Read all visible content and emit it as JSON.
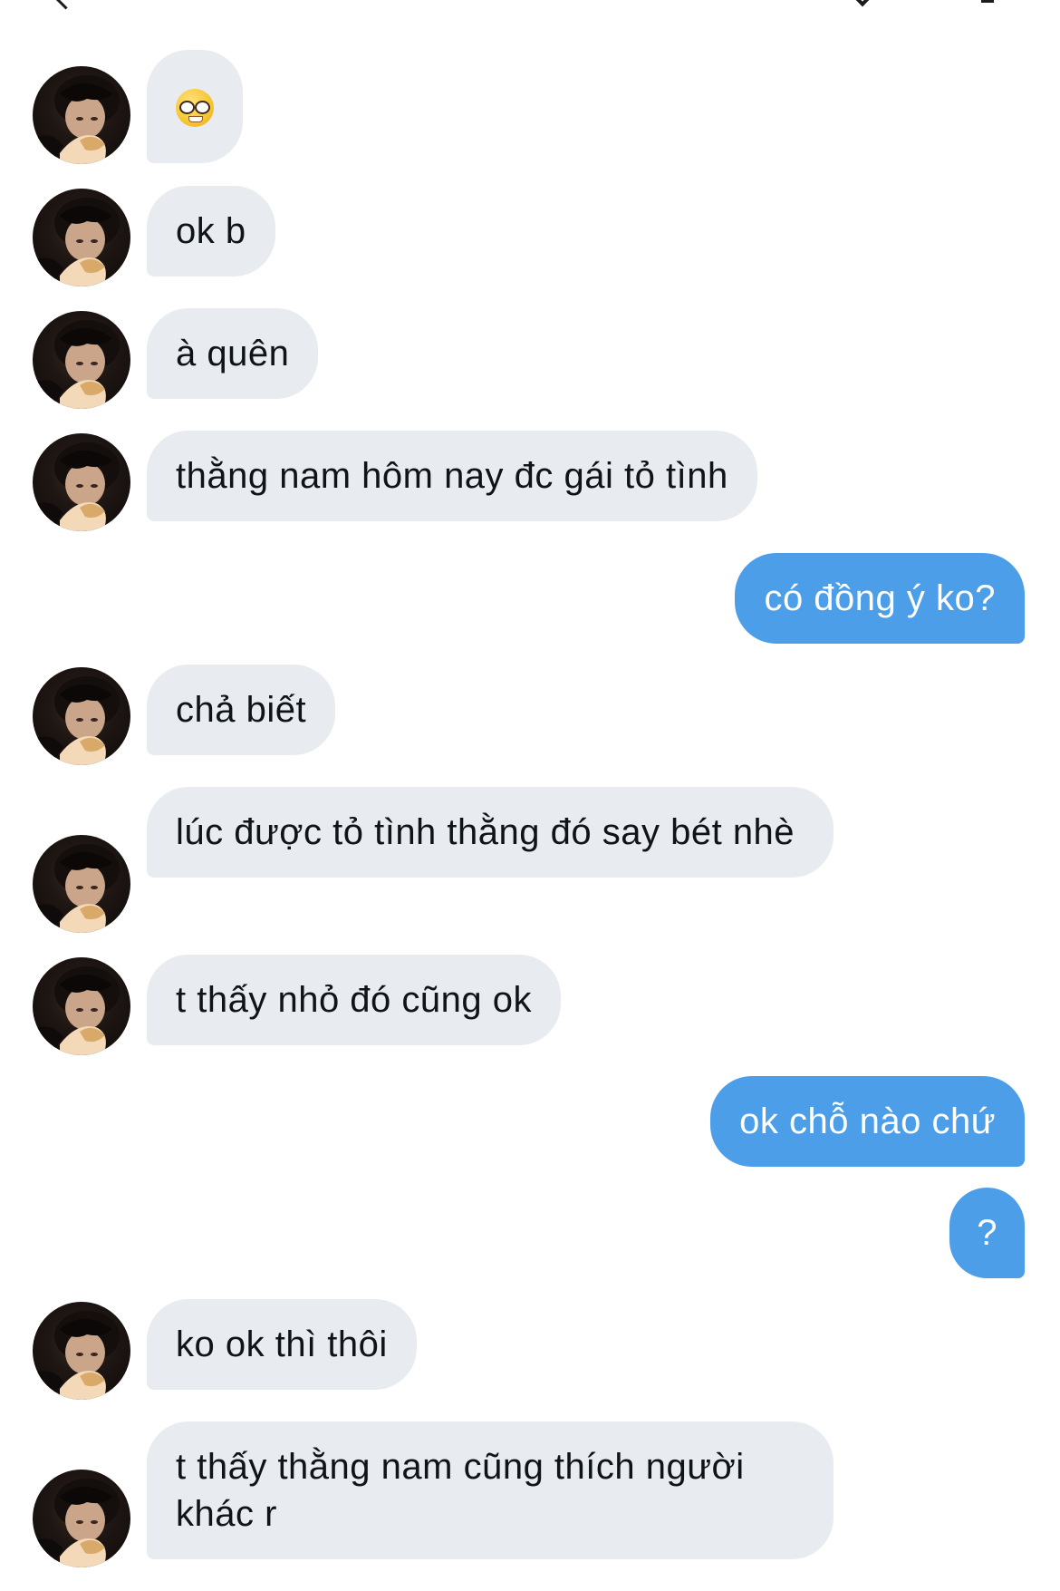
{
  "conversation": {
    "messages": [
      {
        "id": "m1",
        "from": "them",
        "text": "🤓",
        "kind": "emoji",
        "emoji_name": "nerd-face-emoji"
      },
      {
        "id": "m2",
        "from": "them",
        "text": "ok b"
      },
      {
        "id": "m3",
        "from": "them",
        "text": "à quên"
      },
      {
        "id": "m4",
        "from": "them",
        "text": "thằng nam hôm nay đc gái tỏ tình"
      },
      {
        "id": "m5",
        "from": "me",
        "text": "có đồng ý ko?"
      },
      {
        "id": "m6",
        "from": "them",
        "text": "chả biết"
      },
      {
        "id": "m7",
        "from": "them",
        "text": "lúc được tỏ tình thằng đó say bét nhè"
      },
      {
        "id": "m8",
        "from": "them",
        "text": "t thấy nhỏ đó cũng ok"
      },
      {
        "id": "m9",
        "from": "me",
        "text": "ok chỗ nào chứ"
      },
      {
        "id": "m10",
        "from": "me",
        "text": "?"
      },
      {
        "id": "m11",
        "from": "them",
        "text": "ko ok thì thôi"
      },
      {
        "id": "m12",
        "from": "them",
        "text": "t thấy thằng nam cũng thích người khác r"
      }
    ]
  },
  "theme": {
    "incoming_bubble_color": "#e8ebef",
    "outgoing_bubble_color": "#4c9ee9",
    "incoming_text_color": "#0f1419",
    "outgoing_text_color": "#ffffff"
  },
  "icons": {
    "avatar": "contact-avatar",
    "back": "chevron-left-icon",
    "info": "info-icon"
  }
}
